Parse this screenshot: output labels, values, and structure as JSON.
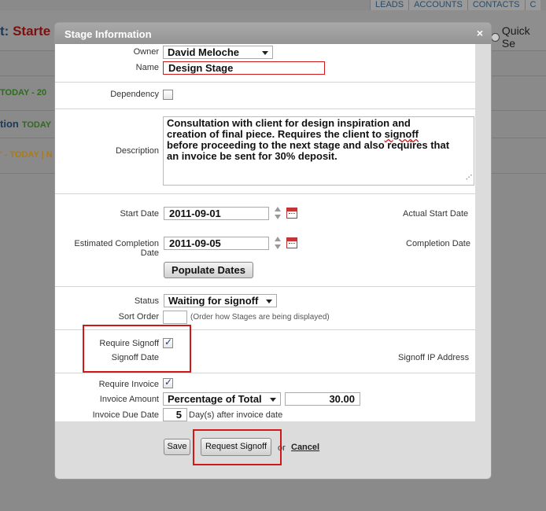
{
  "background": {
    "nav": [
      "LEADS",
      "ACCOUNTS",
      "CONTACTS",
      "C"
    ],
    "title_prefix": "t:",
    "title_value": "Starte",
    "quick_search": "Quick Se",
    "row1": "TODAY - 20",
    "row2_a": "tion",
    "row2_b": "TODAY",
    "row3": "' - TODAY | N"
  },
  "dialog": {
    "title": "Stage Information",
    "close": "×",
    "owner": {
      "label": "Owner",
      "value": "David Meloche"
    },
    "name": {
      "label": "Name",
      "value": "Design Stage"
    },
    "dependency": {
      "label": "Dependency"
    },
    "description": {
      "label": "Description",
      "value_1": "Consultation with client for design inspiration and",
      "value_2": "creation of final piece.  Requires the client to ",
      "value_2_marked": "signoff",
      "value_3": "before proceeding to the next stage and also requires that",
      "value_4": "an invoice be sent for 30% deposit."
    },
    "start_date": {
      "label": "Start Date",
      "value": "2011-09-01"
    },
    "actual_start_date": {
      "label": "Actual Start Date"
    },
    "est_completion": {
      "label": "Estimated Completion Date",
      "value": "2011-09-05"
    },
    "completion_date": {
      "label": "Completion Date"
    },
    "populate_dates": "Populate Dates",
    "status": {
      "label": "Status",
      "value": "Waiting for signoff"
    },
    "sort_order": {
      "label": "Sort Order",
      "value": "",
      "note": "(Order how Stages are being displayed)"
    },
    "require_signoff": {
      "label": "Require Signoff",
      "checked": true
    },
    "signoff_date": {
      "label": "Signoff Date"
    },
    "signoff_ip": {
      "label": "Signoff IP Address"
    },
    "require_invoice": {
      "label": "Require Invoice",
      "checked": true
    },
    "invoice_amount": {
      "label": "Invoice Amount",
      "type": "Percentage of Total",
      "value": "30.00"
    },
    "invoice_due": {
      "label": "Invoice Due Date",
      "value": "5",
      "suffix": "Day(s) after invoice date"
    },
    "buttons": {
      "save": "Save",
      "request_signoff": "Request Signoff",
      "or": "or",
      "cancel": "Cancel"
    }
  },
  "colors": {
    "highlight_red": "#d01818",
    "header_gray": "#9e9e9e"
  }
}
